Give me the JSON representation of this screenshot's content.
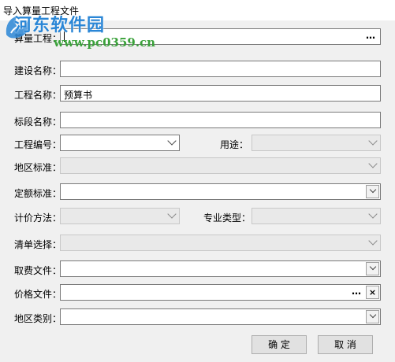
{
  "window": {
    "title": "导入算量工程文件"
  },
  "watermark": {
    "site_name": "河东软件园",
    "url": "www.pc0359.cn"
  },
  "form": {
    "project_file": {
      "label": "算量工程：",
      "value": ""
    },
    "construction_name": {
      "label": "建设名称：",
      "value": ""
    },
    "project_name": {
      "label": "工程名称：",
      "value": "预算书"
    },
    "section_name": {
      "label": "标段名称：",
      "value": ""
    },
    "project_code": {
      "label": "工程编号：",
      "value": ""
    },
    "usage": {
      "label": "用途：",
      "value": ""
    },
    "region_standard": {
      "label": "地区标准：",
      "value": ""
    },
    "quota_standard": {
      "label": "定额标准：",
      "value": ""
    },
    "pricing_method": {
      "label": "计价方法：",
      "value": ""
    },
    "specialty_type": {
      "label": "专业类型：",
      "value": ""
    },
    "bill_selection": {
      "label": "清单选择：",
      "value": ""
    },
    "fee_file": {
      "label": "取费文件：",
      "value": ""
    },
    "price_file": {
      "label": "价格文件：",
      "value": ""
    },
    "region_category": {
      "label": "地区类别：",
      "value": ""
    }
  },
  "buttons": {
    "ok": "确 定",
    "cancel": "取 消",
    "browse": "…",
    "clear": "×"
  }
}
